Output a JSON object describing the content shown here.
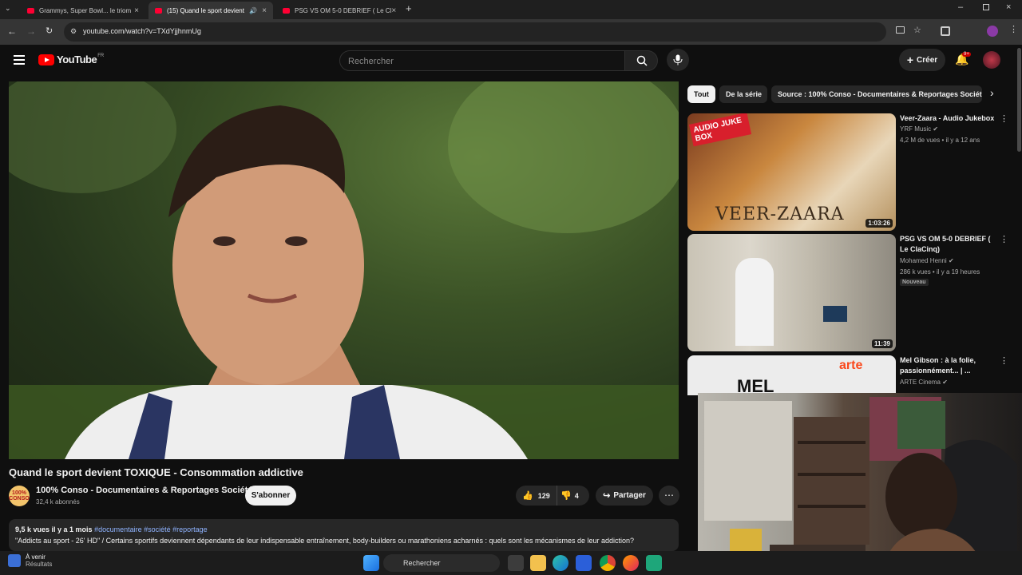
{
  "browser": {
    "tabs": [
      {
        "title": "Grammys, Super Bowl... le triom"
      },
      {
        "title": "(15) Quand le sport devient"
      },
      {
        "title": "PSG VS OM 5-0 DEBRIEF ( Le Cl"
      }
    ],
    "url": "youtube.com/watch?v=TXdYjjhnmUg"
  },
  "header": {
    "logo": "YouTube",
    "logo_region": "FR",
    "search_placeholder": "Rechercher",
    "create_label": "Créer",
    "notif_count": "9+"
  },
  "video": {
    "title": "Quand le sport devient TOXIQUE - Consommation addictive",
    "channel_name": "100% Conso - Documentaires & Reportages Société",
    "channel_avatar_text": "100% CONSO",
    "subscribers": "32,4 k abonnés",
    "subscribe_label": "S'abonner",
    "likes": "129",
    "dislikes": "4",
    "share_label": "Partager",
    "views_and_date": "9,5 k vues  il y a 1 mois",
    "tags": "#documentaire #société #reportage",
    "description": "\"Addicts au sport - 26' HD\" / Certains sportifs deviennent dépendants de leur indispensable entraînement, body-builders ou marathoniens acharnés : quels sont les mécanismes de leur addiction?"
  },
  "chips": [
    {
      "label": "Tout"
    },
    {
      "label": "De la série"
    },
    {
      "label": "Source : 100% Conso - Documentaires & Reportages Société"
    }
  ],
  "recommendations": [
    {
      "title": "Veer-Zaara - Audio Jukebox",
      "channel": "YRF Music",
      "meta": "4,2 M de vues • il y a 12 ans",
      "duration": "1:03:26",
      "thumb_text": "VEER-ZAARA",
      "thumb_badge": "AUDIO JUKE BOX"
    },
    {
      "title": "PSG VS OM 5-0 DEBRIEF ( Le ClaCinq)",
      "channel": "Mohamed Henni",
      "meta": "286 k vues • il y a 19 heures",
      "badge": "Nouveau",
      "duration": "11:39"
    },
    {
      "title": "Mel Gibson : à la folie, passionnément... | ...",
      "channel": "ARTE Cinema",
      "thumb_text": "MEL",
      "thumb_badge": "arte"
    }
  ],
  "taskbar": {
    "weather_title": "À venir",
    "weather_sub": "Résultats",
    "search_label": "Rechercher"
  }
}
